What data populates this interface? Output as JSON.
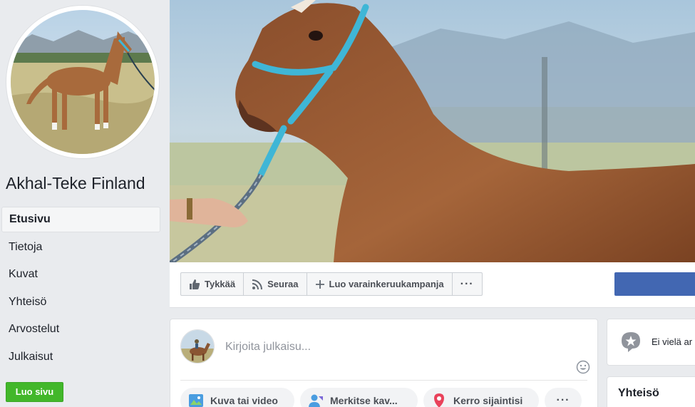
{
  "page": {
    "name": "Akhal-Teke Finland"
  },
  "nav": {
    "items": [
      {
        "label": "Etusivu",
        "active": true
      },
      {
        "label": "Tietoja",
        "active": false
      },
      {
        "label": "Kuvat",
        "active": false
      },
      {
        "label": "Yhteisö",
        "active": false
      },
      {
        "label": "Arvostelut",
        "active": false
      },
      {
        "label": "Julkaisut",
        "active": false
      }
    ],
    "create_page": "Luo sivu"
  },
  "actions": {
    "like": "Tykkää",
    "follow": "Seuraa",
    "fundraiser": "Luo varainkeruukampanja",
    "more": "···"
  },
  "composer": {
    "placeholder": "Kirjoita julkaisu...",
    "chips": {
      "photo": "Kuva tai video",
      "tag": "Merkitse kav...",
      "checkin": "Kerro sijaintisi",
      "more": "···"
    }
  },
  "right": {
    "rating_text": "Ei vielä ar",
    "community_title": "Yhteisö"
  },
  "colors": {
    "facebook_blue": "#4267b2",
    "create_green": "#42b72a",
    "bridle_cyan": "#3fb6d6",
    "horse_chestnut": "#9a5a32"
  }
}
